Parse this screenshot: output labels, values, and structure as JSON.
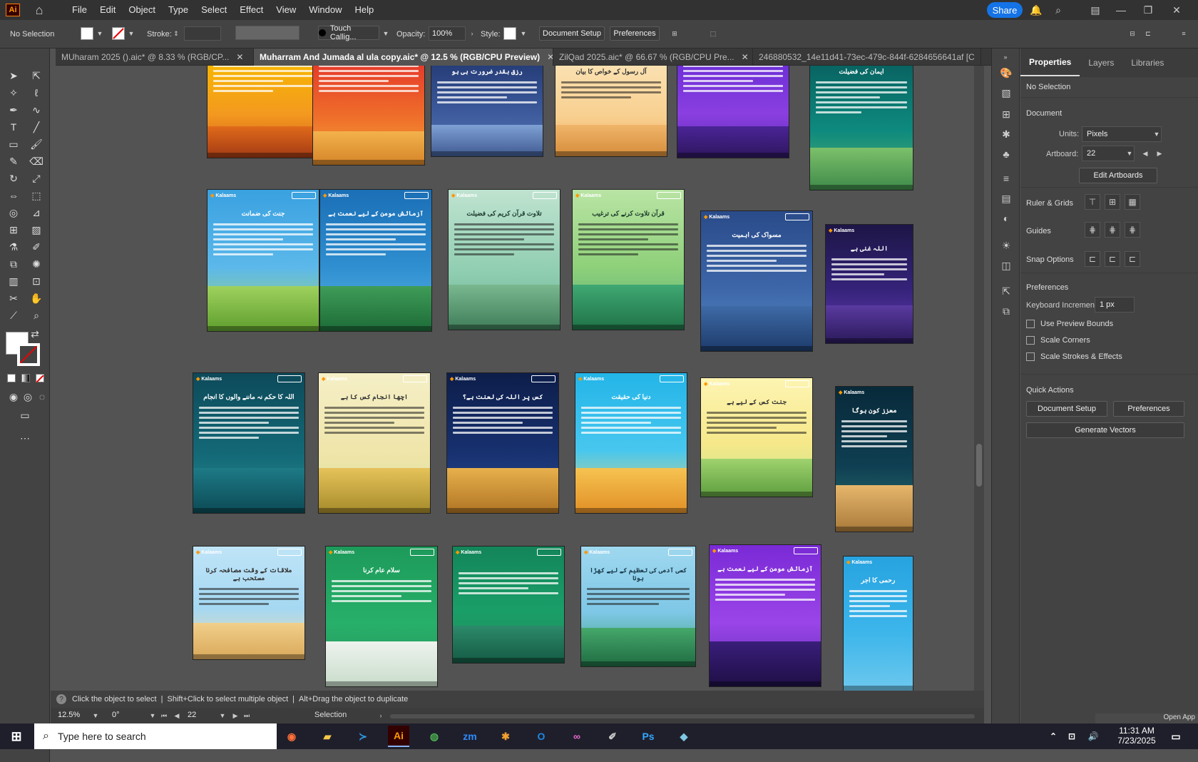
{
  "menubar": {
    "app_logo": "Ai",
    "menus": [
      "File",
      "Edit",
      "Object",
      "Type",
      "Select",
      "Effect",
      "View",
      "Window",
      "Help"
    ],
    "share_label": "Share"
  },
  "controlbar": {
    "selection": "No Selection",
    "stroke_label": "Stroke:",
    "brush": "Touch Callig...",
    "opacity_label": "Opacity:",
    "opacity_value": "100%",
    "style_label": "Style:",
    "document_setup": "Document Setup",
    "preferences": "Preferences"
  },
  "tabs": [
    {
      "label": "MUharam 2025 ().aic* @ 8.33 % (RGB/CP...",
      "active": false
    },
    {
      "label": "Muharram And Jumada al ula copy.aic* @ 12.5 % (RGB/CPU Preview)",
      "active": true
    },
    {
      "label": "ZilQad 2025.aic* @ 66.67 % (RGB/CPU Pre...",
      "active": false
    },
    {
      "label": "246880532_14e11d41-73ec-479c-844f-6284656641af [C",
      "active": false
    }
  ],
  "artboard_titles": {
    "r2c1": "جنت کی ضمانت",
    "r2c2": "آزمائش مومن کے لیے نعمت ہے",
    "r2c3": "تلاوت قرآن کریم کی فضیلت",
    "r2c4": "قرآن تلاوت کرنے کی ترغیب",
    "r2c5": "مسواک کی اہمیت",
    "r2c6": "اللہ غنی ہے",
    "r3c1": "اللہ کا حکم نہ ماننے والوں کا انجام",
    "r3c2": "اچھا انجام کس کا ہے",
    "r3c3": "کس پر اللہ کی لعنت ہے؟",
    "r3c4": "دنیا کی حقیقت",
    "r3c5": "جنت کس کے لیے ہے",
    "r3c6": "معزز کون ہوگا",
    "r4c1": "ملاقات کے وقت مصافحہ کرنا مستحب ہے",
    "r4c2": "سلام عام کرنا",
    "r4c4": "کسی آدمی کی تعظیم کے لیے کھڑا ہونا",
    "r4c5": "آزمائش مومن کے لیے نعمت ہے",
    "r4c6": "رحمی کا اجر",
    "r1c1": "ایمان کی فضیلت",
    "r1c2": "رزق بقدر ضرورت ہی ہو",
    "r1c3": "آل رسول کے خواص کا بیان"
  },
  "artboard_brand": "Kalaams",
  "hint": {
    "click": "Click the object to select",
    "shift": "Shift+Click to select multiple object",
    "alt": "Alt+Drag the object to duplicate"
  },
  "status": {
    "zoom": "12.5%",
    "rotation": "0°",
    "artboard_num": "22",
    "mode": "Selection"
  },
  "properties": {
    "tabs": [
      "Properties",
      "Layers",
      "Libraries"
    ],
    "selection": "No Selection",
    "document_heading": "Document",
    "units_label": "Units:",
    "units_value": "Pixels",
    "artboard_label": "Artboard:",
    "artboard_value": "22",
    "edit_artboards": "Edit Artboards",
    "ruler_grids": "Ruler & Grids",
    "guides": "Guides",
    "snap_options": "Snap Options",
    "preferences_heading": "Preferences",
    "keyboard_increment_label": "Keyboard Increment:",
    "keyboard_increment_value": "1 px",
    "use_preview_bounds": "Use Preview Bounds",
    "scale_corners": "Scale Corners",
    "scale_strokes": "Scale Strokes & Effects",
    "quick_actions": "Quick Actions",
    "document_setup": "Document Setup",
    "preferences": "Preferences",
    "generate_vectors": "Generate Vectors"
  },
  "taskbar": {
    "search_placeholder": "Type here to search",
    "time": "11:31 AM",
    "date": "7/23/2025",
    "open_app": "Open App"
  }
}
